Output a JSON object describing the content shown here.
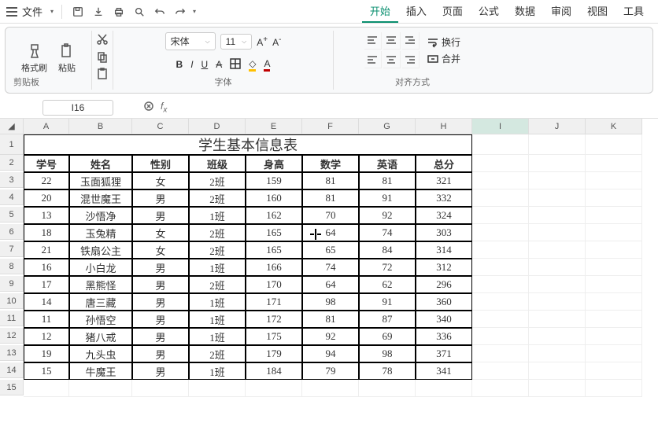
{
  "menu": {
    "file": "文件",
    "tabs": [
      "开始",
      "插入",
      "页面",
      "公式",
      "数据",
      "审阅",
      "视图",
      "工具"
    ],
    "activeTab": 0
  },
  "ribbon": {
    "clipboard": {
      "label": "剪贴板",
      "formatBrush": "格式刷",
      "paste": "粘贴"
    },
    "font": {
      "label": "字体",
      "name": "宋体",
      "size": "11"
    },
    "align": {
      "label": "对齐方式",
      "wrap": "换行",
      "merge": "合并"
    }
  },
  "namebox": "I16",
  "columns": [
    "A",
    "B",
    "C",
    "D",
    "E",
    "F",
    "G",
    "H",
    "I",
    "J",
    "K"
  ],
  "selectedCol": "I",
  "title": "学生基本信息表",
  "headers": [
    "学号",
    "姓名",
    "性别",
    "班级",
    "身高",
    "数学",
    "英语",
    "总分"
  ],
  "rows": [
    [
      "22",
      "玉面狐狸",
      "女",
      "2班",
      "159",
      "81",
      "81",
      "321"
    ],
    [
      "20",
      "混世魔王",
      "男",
      "2班",
      "160",
      "81",
      "91",
      "332"
    ],
    [
      "13",
      "沙悟净",
      "男",
      "1班",
      "162",
      "70",
      "92",
      "324"
    ],
    [
      "18",
      "玉兔精",
      "女",
      "2班",
      "165",
      "64",
      "74",
      "303"
    ],
    [
      "21",
      "铁扇公主",
      "女",
      "2班",
      "165",
      "65",
      "84",
      "314"
    ],
    [
      "16",
      "小白龙",
      "男",
      "1班",
      "166",
      "74",
      "72",
      "312"
    ],
    [
      "17",
      "黑熊怪",
      "男",
      "2班",
      "170",
      "64",
      "62",
      "296"
    ],
    [
      "14",
      "唐三藏",
      "男",
      "1班",
      "171",
      "98",
      "91",
      "360"
    ],
    [
      "11",
      "孙悟空",
      "男",
      "1班",
      "172",
      "81",
      "87",
      "340"
    ],
    [
      "12",
      "猪八戒",
      "男",
      "1班",
      "175",
      "92",
      "69",
      "336"
    ],
    [
      "19",
      "九头虫",
      "男",
      "2班",
      "179",
      "94",
      "98",
      "371"
    ],
    [
      "15",
      "牛魔王",
      "男",
      "1班",
      "184",
      "79",
      "78",
      "341"
    ]
  ]
}
